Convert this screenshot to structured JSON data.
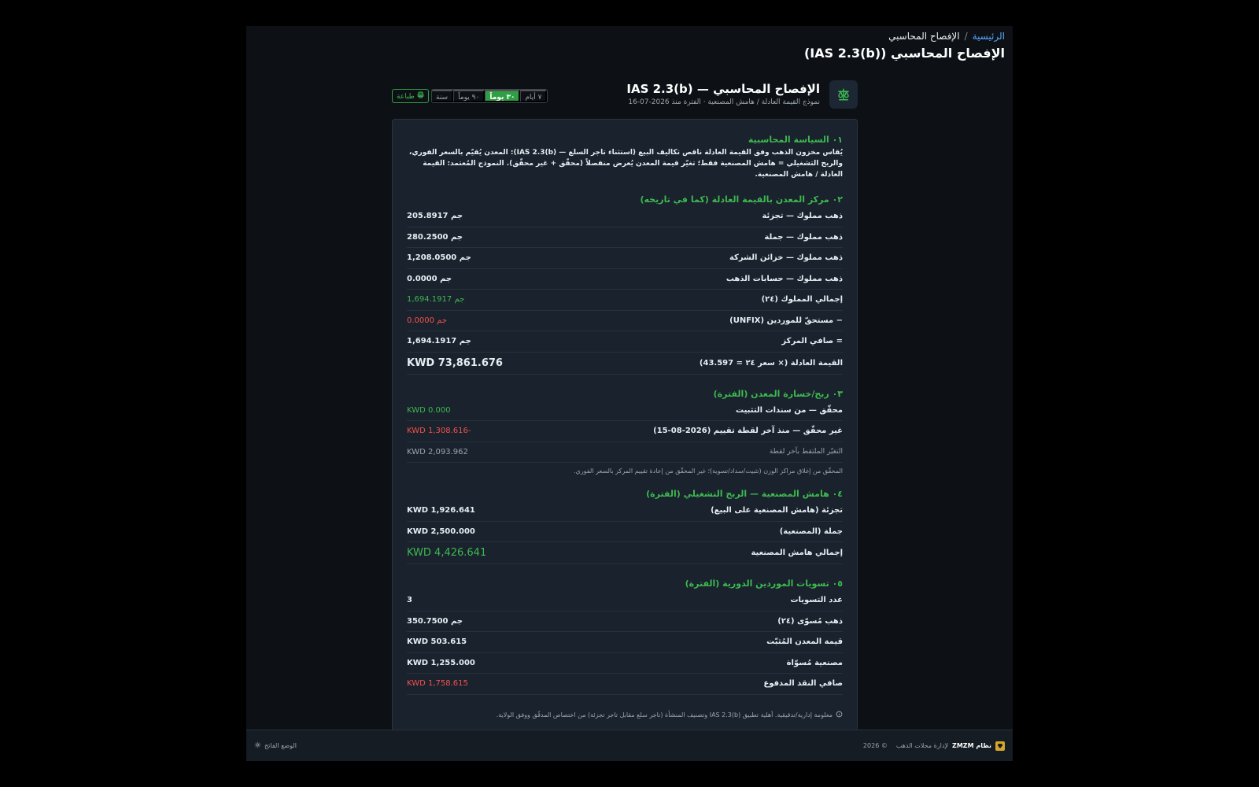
{
  "breadcrumb": {
    "home": "الرئيسية",
    "separator": "/",
    "current": "الإفصاح المحاسبي"
  },
  "page_title": "الإفصاح المحاسبي (IAS 2.3(b))",
  "report": {
    "icon": "scale-icon",
    "title": "الإفصاح المحاسبي — IAS 2.3(b)",
    "subtitle": "نموذج القيمة العادلة / هامش المصنعية · الفترة منذ 2026-07-16",
    "periods": [
      "٧ أيام",
      "٣٠ يوماً",
      "٩٠ يوماً",
      "سنة"
    ],
    "active_period": "٣٠ يوماً",
    "print_label": "طباعة"
  },
  "section1": {
    "title": "٠١ السياسة المحاسبية",
    "text": "يُقاس مخزون الذهب وفق القيمة العادلة ناقص تكاليف البيع (استثناء تاجر السلع — IAS 2.3(b)): المعدن يُقيّم بالسعر الفوري، والربح التشغيلي = هامش المصنعية فقط؛ تغيّر قيمة المعدن يُعرض منفصلاً (محقّق + غير محقّق). النموذج المُعتمد: القيمة العادلة / هامش المصنعية."
  },
  "section2": {
    "title": "٠٢ مركز المعدن بالقيمة العادلة (كما في تاريخه)",
    "rows": [
      {
        "label": "ذهب مملوك — تجزئة",
        "value": "205.8917 جم"
      },
      {
        "label": "ذهب مملوك — جملة",
        "value": "280.2500 جم"
      },
      {
        "label": "ذهب مملوك — خزائن الشركة",
        "value": "1,208.0500 جم"
      },
      {
        "label": "ذهب مملوك — حسابات الذهب",
        "value": "0.0000 جم"
      },
      {
        "label": "إجمالي المملوك (٢٤)",
        "value": "1,694.1917 جم"
      },
      {
        "label": "− مستحقّ للموردين (UNFIX)",
        "value": "0.0000 جم"
      },
      {
        "label": "= صافي المركز",
        "value": "1,694.1917 جم"
      },
      {
        "label": "القيمة العادلة (× سعر ٢٤ = 43.597)",
        "value": "KWD 73,861.676"
      }
    ]
  },
  "section3": {
    "title": "٠٣ ربح/خسارة المعدن (الفترة)",
    "rows": [
      {
        "label": "محقّق — من سندات التثبيت",
        "value": "KWD 0.000"
      },
      {
        "label": "غير محقّق — منذ آخر لقطة تقييم (2026-08-15)",
        "value": "KWD 1,308.616-"
      },
      {
        "label": "التغيّر الملتقط بآخر لقطة",
        "value": "KWD 2,093.962"
      }
    ],
    "note": "المحقّق من إغلاق مراكز الوزن (تثبيت/سداد/تسوية)؛ غير المحقّق من إعادة تقييم المركز بالسعر الفوري."
  },
  "section4": {
    "title": "٠٤ هامش المصنعية — الربح التشغيلي (الفترة)",
    "rows": [
      {
        "label": "تجزئة (هامش المصنعية على البيع)",
        "value": "KWD 1,926.641"
      },
      {
        "label": "جملة (المصنعية)",
        "value": "KWD 2,500.000"
      },
      {
        "label": "إجمالي هامش المصنعية",
        "value": "KWD 4,426.641"
      }
    ]
  },
  "section5": {
    "title": "٠٥ تسويات الموردين الدورية (الفترة)",
    "rows": [
      {
        "label": "عدد التسويات",
        "value": "3"
      },
      {
        "label": "ذهب مُسوّى (٢٤)",
        "value": "350.7500 جم"
      },
      {
        "label": "قيمة المعدن المُثبّت",
        "value": "KWD 503.615"
      },
      {
        "label": "مصنعية مُسوّاة",
        "value": "KWD 1,255.000"
      },
      {
        "label": "صافي النقد المدفوع",
        "value": "KWD 1,758.615"
      }
    ]
  },
  "footnote": "معلومة إدارية/تدقيقية. أهلية تطبيق IAS 2.3(b) وتصنيف المنشأة (تاجر سلع مقابل تاجر تجزئة) من اختصاص المدقّق ووفق الولاية.",
  "footer": {
    "brand_icon": "diamond-icon",
    "brand_name": "نظام ZMZM",
    "brand_desc": "لإدارة محلات الذهب",
    "copyright": "© 2026",
    "theme_label": "الوضع الفاتح"
  }
}
